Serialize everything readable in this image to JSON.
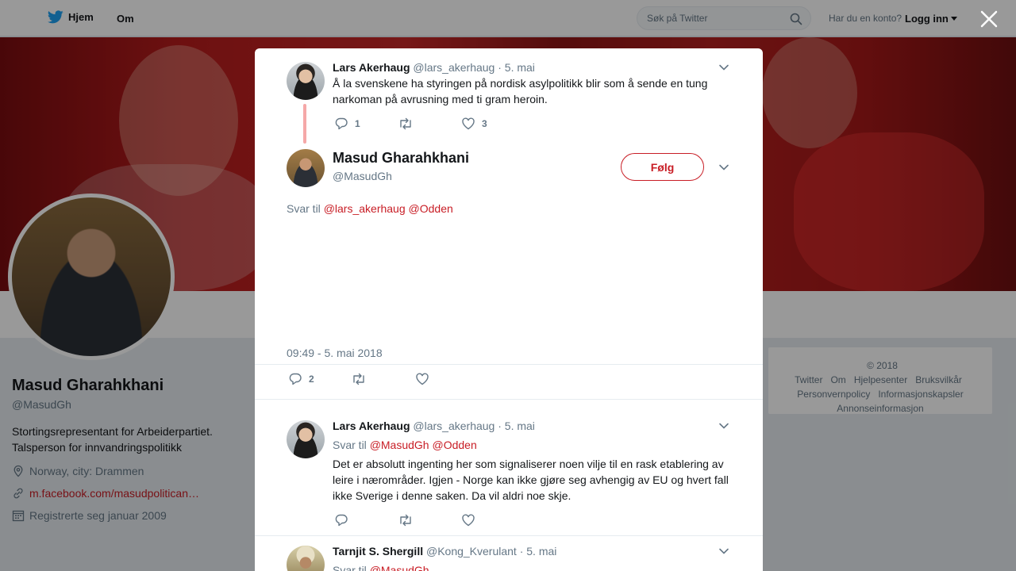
{
  "nav": {
    "home_label": "Hjem",
    "about_label": "Om",
    "search_placeholder": "Søk på Twitter",
    "account_prompt": "Har du en konto?",
    "login_label": "Logg inn"
  },
  "profile": {
    "name": "Masud Gharahkhani",
    "handle": "@MasudGh",
    "bio_line1": "Stortingsrepresentant for Arbeiderpartiet.",
    "bio_line2": "Talsperson for innvandringspolitikk",
    "location": "Norway, city: Drammen",
    "website": "m.facebook.com/masudpolitican…",
    "joined": "Registrerte seg januar 2009"
  },
  "footer": {
    "items": [
      "© 2018 Twitter",
      "Om",
      "Hjelpesenter",
      "Bruksvilkår",
      "Personvernpolicy",
      "Informasjonskapsler",
      "Annonseinformasjon"
    ]
  },
  "modal": {
    "parent_tweet": {
      "name": "Lars Akerhaug",
      "handle": "@lars_akerhaug",
      "date": "· 5. mai",
      "text": "Å la svenskene ha styringen på nordisk asylpolitikk blir som å sende en tung narkoman på avrusning med ti gram heroin.",
      "replies": "1",
      "retweets": "",
      "likes": "3"
    },
    "main_tweet": {
      "name": "Masud Gharahkhani",
      "handle": "@MasudGh",
      "follow_label": "Følg",
      "reply_prefix": "Svar til",
      "reply_mention1": "@lars_akerhaug",
      "reply_mention2": "@Odden",
      "timestamp": "09:49 - 5. mai 2018",
      "replies": "2",
      "retweets": "",
      "likes": ""
    },
    "reply1": {
      "name": "Lars Akerhaug",
      "handle": "@lars_akerhaug",
      "date": "· 5. mai",
      "reply_prefix": "Svar til",
      "reply_mention1": "@MasudGh",
      "reply_mention2": "@Odden",
      "text": "Det er absolutt ingenting her som signaliserer noen vilje til en rask etablering av leire i nærområder. Igjen - Norge kan ikke gjøre seg avhengig av EU og hvert fall ikke Sverige i denne saken. Da vil aldri noe skje."
    },
    "reply2": {
      "name": "Tarnjit S. Shergill",
      "handle": "@Kong_Kverulant",
      "date": "· 5. mai",
      "reply_prefix": "Svar til",
      "reply_mention1": "@MasudGh"
    }
  },
  "colors": {
    "accent": "#c81d25",
    "muted_text": "#657786",
    "thread_line": "#f5a8a8"
  }
}
